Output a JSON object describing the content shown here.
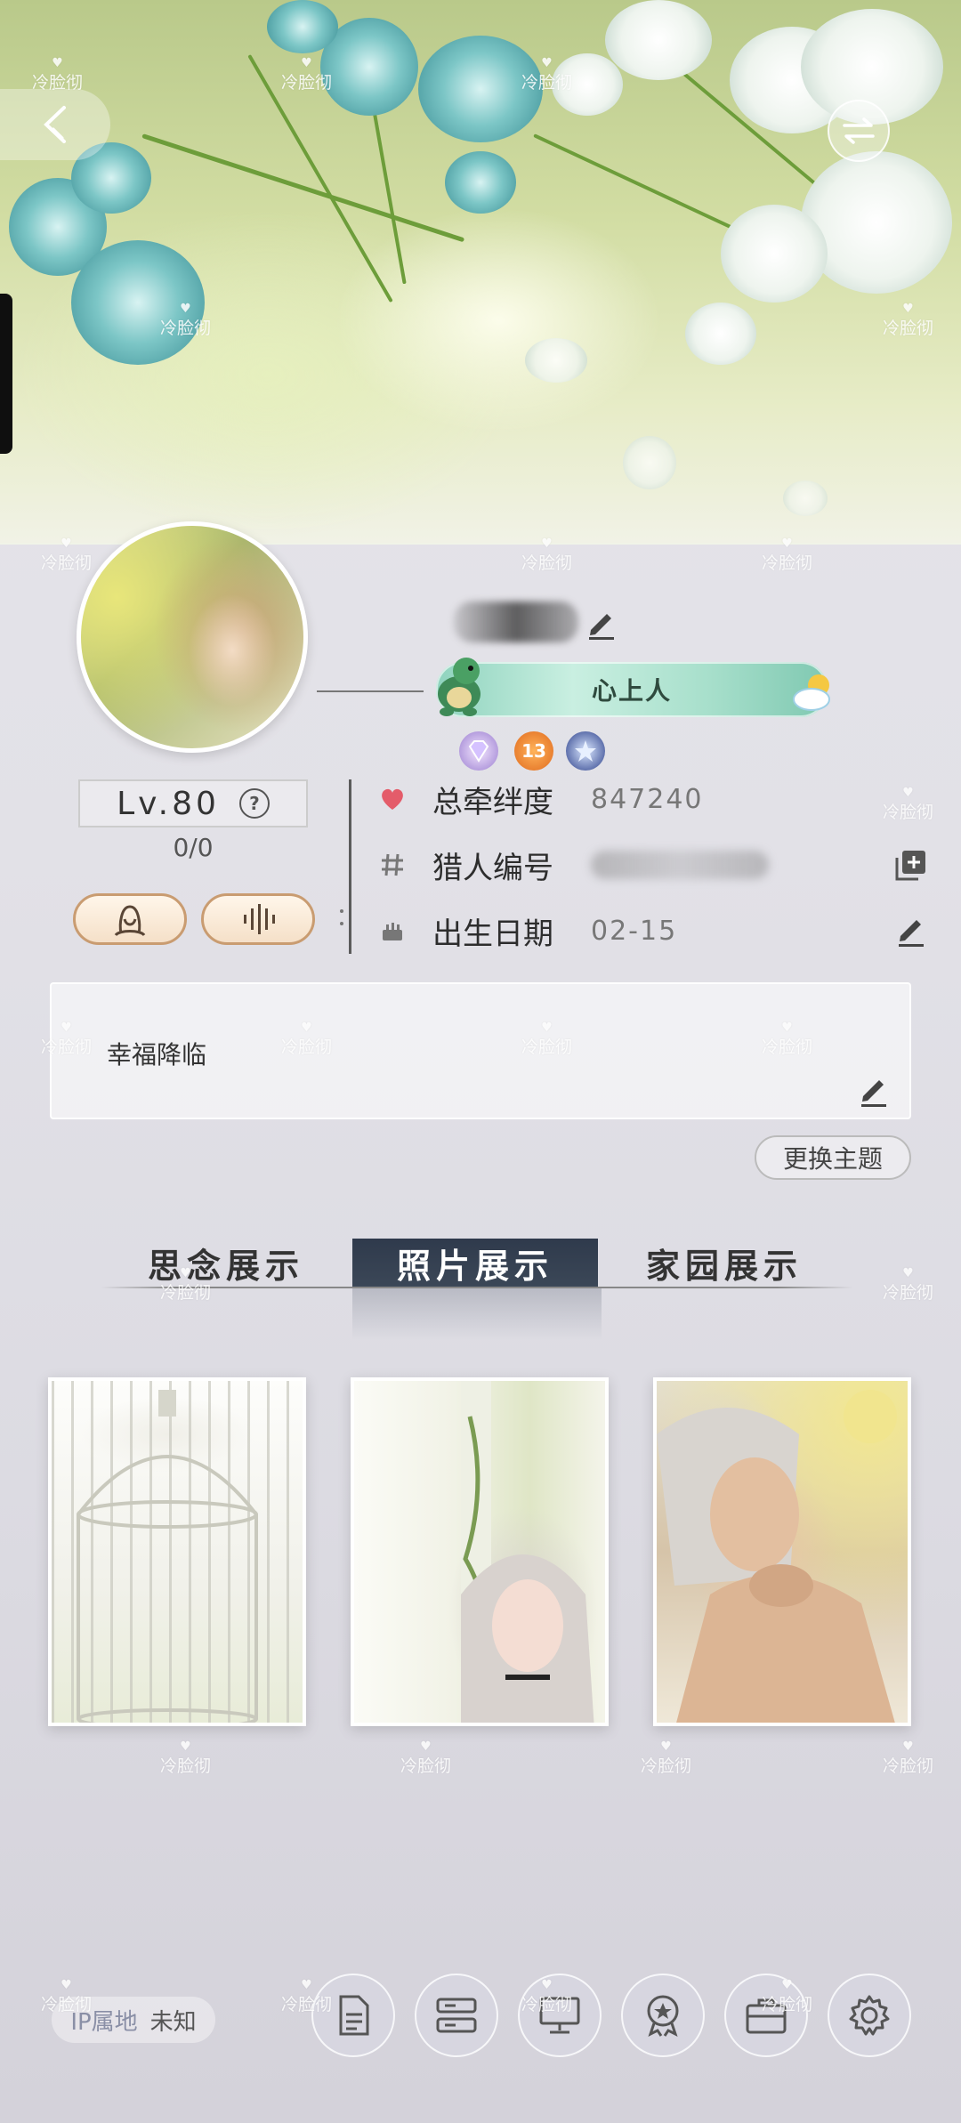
{
  "profile": {
    "badge_title": "心上人",
    "medal_level": "13",
    "level_text": "Lv.80",
    "level_help": "?",
    "exp_text": "0/0"
  },
  "info": {
    "bond_label": "总牵绊度",
    "bond_value": "847240",
    "hunter_id_label": "猎人编号",
    "birthday_label": "出生日期",
    "birthday_value": "02-15"
  },
  "signature": {
    "text": "幸福降临"
  },
  "theme_button": "更换主题",
  "tabs": [
    {
      "label": "思念展示",
      "active": false
    },
    {
      "label": "照片展示",
      "active": true
    },
    {
      "label": "家园展示",
      "active": false
    }
  ],
  "ip": {
    "label": "IP属地",
    "value": "未知"
  },
  "watermark": "冷脸彻",
  "colors": {
    "active_tab_bg": "#333e50",
    "pill_border": "#c99c71",
    "heart": "#e45c6a",
    "badge_green": "#8fd3be"
  },
  "icons": {
    "back": "back-arrow-icon",
    "swap": "swap-icon",
    "edit": "pencil-icon",
    "copy": "copy-plus-icon",
    "bond": "heart-icon",
    "id": "hash-icon",
    "birthday": "cake-icon",
    "bottom": [
      "document-icon",
      "storage-icon",
      "monitor-icon",
      "medal-icon",
      "briefcase-icon",
      "gear-icon"
    ]
  }
}
